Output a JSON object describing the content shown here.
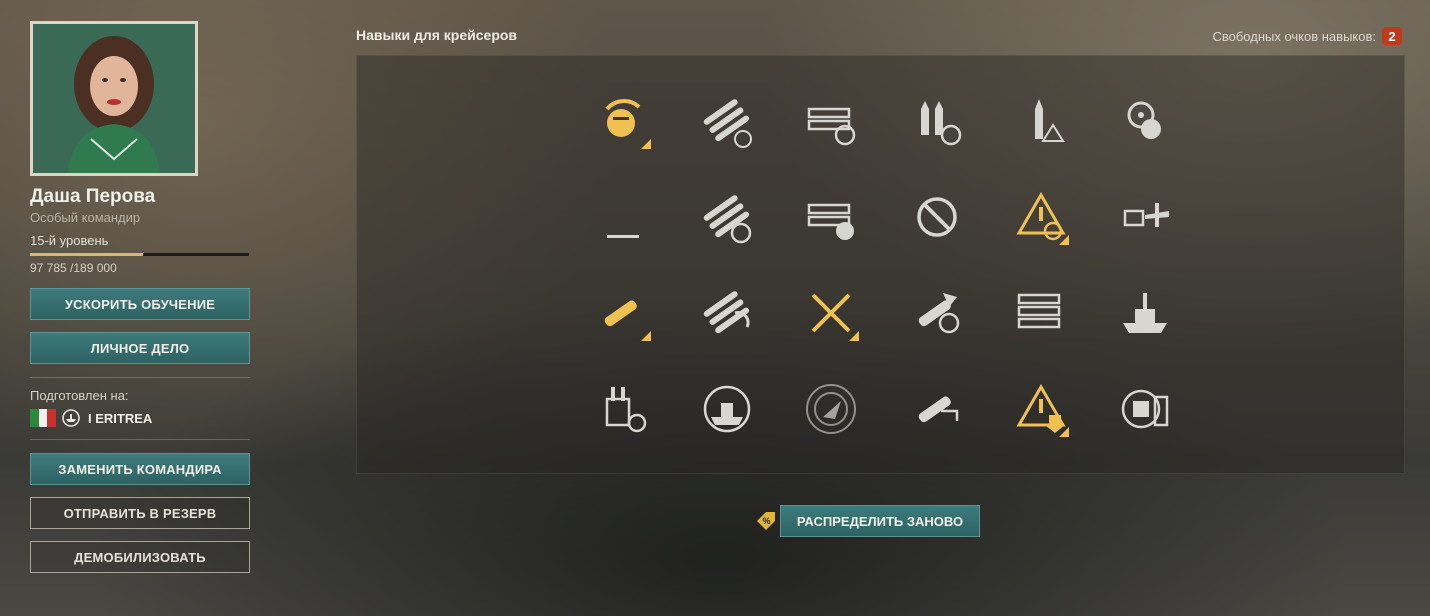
{
  "commander": {
    "name": "Даша Перова",
    "subtitle": "Особый командир",
    "level": "15-й уровень",
    "xp_text": "97 785 /189 000",
    "xp_progress": 0.517
  },
  "buttons": {
    "accelerate": "УСКОРИТЬ ОБУЧЕНИЕ",
    "personal_file": "ЛИЧНОЕ ДЕЛО",
    "replace": "ЗАМЕНИТЬ КОМАНДИРА",
    "reserve": "ОТПРАВИТЬ В РЕЗЕРВ",
    "demobilize": "ДЕМОБИЛИЗОВАТЬ",
    "redistribute": "РАСПРЕДЕЛИТЬ ЗАНОВО"
  },
  "trained": {
    "label": "Подготовлен на:",
    "ship_name": "I ERITREA",
    "nation_flag": "italy-flag",
    "ship_class_icon": "cruiser-class-icon"
  },
  "skills": {
    "title": "Навыки для крейсеров",
    "free_points_label": "Свободных очков навыков:",
    "free_points": "2",
    "rows": [
      [
        {
          "icon": "gun-feeder-icon",
          "active": true
        },
        {
          "icon": "main-battery-reload-icon",
          "active": false
        },
        {
          "icon": "consumable-reload-icon",
          "active": false
        },
        {
          "icon": "ap-shells-reload-icon",
          "active": false
        },
        {
          "icon": "shell-warning-icon",
          "active": false
        },
        {
          "icon": "engine-propeller-icon",
          "active": false
        }
      ],
      [
        {
          "icon": "fire-icon",
          "active": false
        },
        {
          "icon": "torpedo-reload-icon",
          "active": false
        },
        {
          "icon": "consumable-timer-icon",
          "active": false
        },
        {
          "icon": "no-entry-icon",
          "active": false
        },
        {
          "icon": "priority-target-icon",
          "active": true
        },
        {
          "icon": "aa-aircraft-icon",
          "active": false
        }
      ],
      [
        {
          "icon": "he-fire-icon",
          "active": true
        },
        {
          "icon": "torpedo-fire-icon",
          "active": false
        },
        {
          "icon": "crossed-swords-icon",
          "active": true
        },
        {
          "icon": "demolition-icon",
          "active": false
        },
        {
          "icon": "extra-consumables-icon",
          "active": false
        },
        {
          "icon": "ship-hull-icon",
          "active": false
        }
      ],
      [
        {
          "icon": "turret-reload-icon",
          "active": false
        },
        {
          "icon": "ship-radar-icon",
          "active": false
        },
        {
          "icon": "radar-compass-icon",
          "active": false
        },
        {
          "icon": "fire-shield-icon",
          "active": false
        },
        {
          "icon": "warning-down-icon",
          "active": true
        },
        {
          "icon": "secondary-turret-icon",
          "active": false
        }
      ]
    ]
  },
  "colors": {
    "accent_gold": "#f0c050",
    "inactive_icon": "#d8d6d0",
    "teal_button": "#2e6263",
    "badge_red": "#c0391b"
  }
}
